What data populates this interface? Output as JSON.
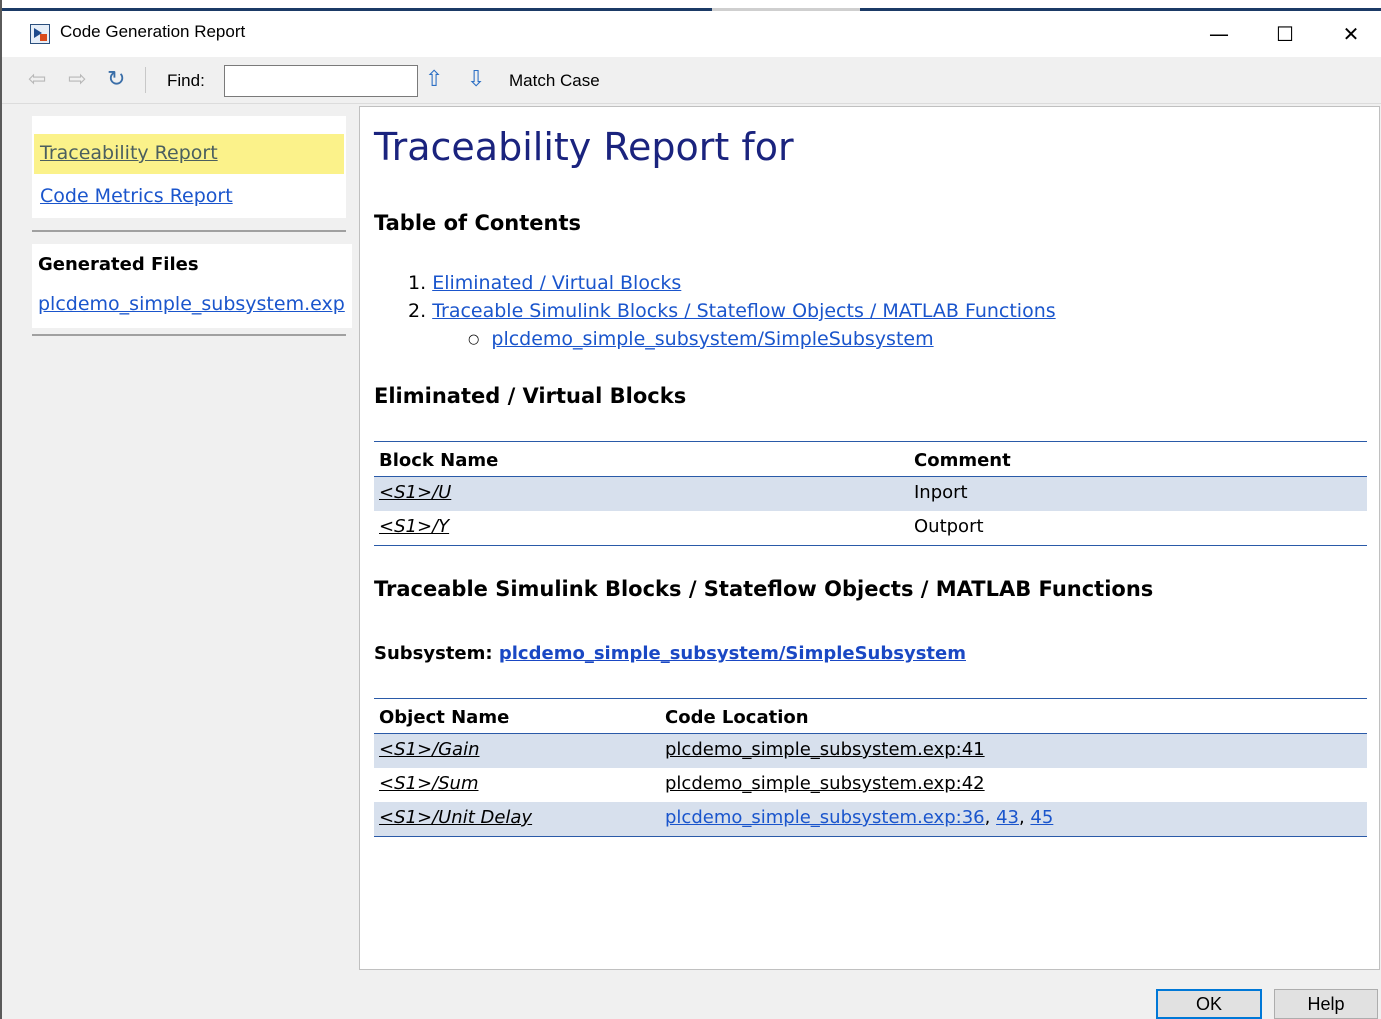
{
  "window": {
    "title": "Code Generation Report",
    "controls": {
      "minimize": "—",
      "maximize": "☐",
      "close": "✕"
    }
  },
  "toolbar": {
    "back_icon": "back-arrow-icon",
    "forward_icon": "forward-arrow-icon",
    "refresh_icon": "refresh-icon",
    "find_label": "Find:",
    "find_value": "",
    "find_placeholder": "",
    "up_icon": "up-arrow-icon",
    "down_icon": "down-arrow-icon",
    "match_case_label": "Match Case"
  },
  "sidebar": {
    "nav": [
      {
        "label": "Traceability Report",
        "active": true
      },
      {
        "label": "Code Metrics Report",
        "active": false
      }
    ],
    "generated_files_title": "Generated Files",
    "files": [
      "plcdemo_simple_subsystem.exp"
    ]
  },
  "main": {
    "title": "Traceability Report for",
    "toc_heading": "Table of Contents",
    "toc": [
      {
        "num": "1.",
        "label": "Eliminated / Virtual Blocks"
      },
      {
        "num": "2.",
        "label": "Traceable Simulink Blocks / Stateflow Objects / MATLAB Functions"
      }
    ],
    "toc_sub": "plcdemo_simple_subsystem/SimpleSubsystem",
    "eliminated_heading": "Eliminated / Virtual Blocks",
    "eliminated_table": {
      "headers": [
        "Block Name",
        "Comment"
      ],
      "rows": [
        {
          "name": "<S1>/U",
          "comment": "Inport"
        },
        {
          "name": "<S1>/Y",
          "comment": "Outport"
        }
      ]
    },
    "traceable_heading": "Traceable Simulink Blocks / Stateflow Objects / MATLAB Functions",
    "subsystem_label": "Subsystem:",
    "subsystem_link": "plcdemo_simple_subsystem/SimpleSubsystem",
    "traceable_table": {
      "headers": [
        "Object Name",
        "Code Location"
      ],
      "rows": [
        {
          "name": "<S1>/Gain",
          "loc": "plcdemo_simple_subsystem.exp:41",
          "extra1": "",
          "extra2": ""
        },
        {
          "name": "<S1>/Sum",
          "loc": "plcdemo_simple_subsystem.exp:42",
          "extra1": "",
          "extra2": ""
        },
        {
          "name": "<S1>/Unit Delay",
          "loc": "plcdemo_simple_subsystem.exp:36",
          "extra1": "43",
          "extra2": "45"
        }
      ]
    }
  },
  "buttons": {
    "ok": "OK",
    "help": "Help"
  }
}
